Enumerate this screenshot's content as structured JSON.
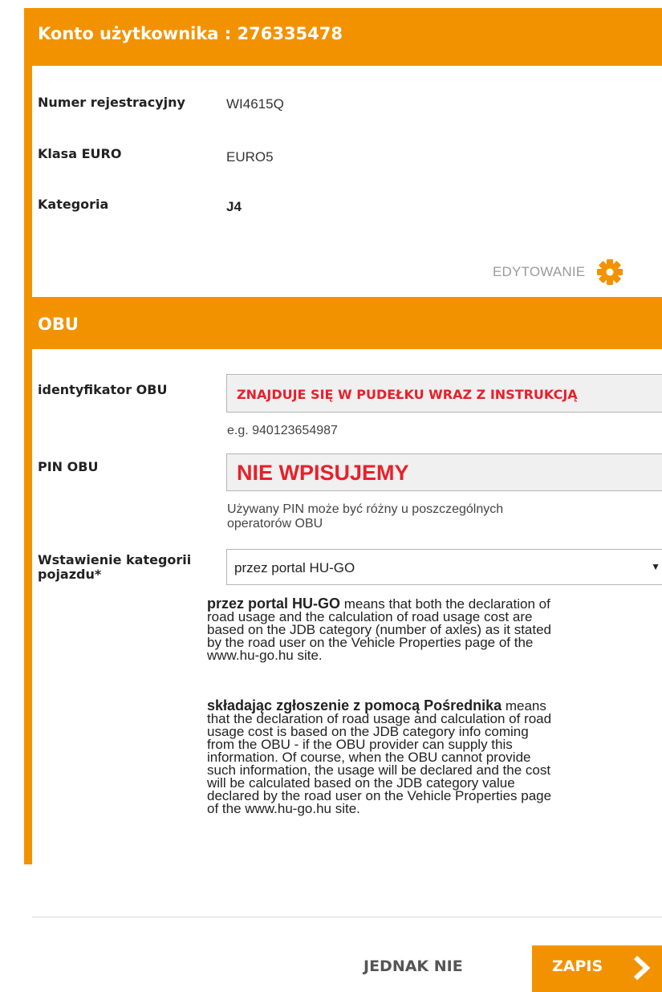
{
  "account": {
    "title": "Konto użytkownika : 276335478",
    "fields": [
      {
        "label": "Numer rejestracyjny",
        "value": "WI4615Q"
      },
      {
        "label": "Klasa EURO",
        "value": "EURO5"
      },
      {
        "label": "Kategoria",
        "value": "J4"
      }
    ],
    "edit_label": "EDYTOWANIE"
  },
  "obu": {
    "title": "OBU",
    "id_label": "identyfikator OBU",
    "id_value": "ZNAJDUJE SIĘ W PUDEŁKU WRAZ Z INSTRUKCJĄ",
    "id_hint": "e.g. 940123654987",
    "pin_label": "PIN OBU",
    "pin_value": "NIE WPISUJEMY",
    "pin_hint_1": "Używany PIN może być różny u poszczególnych",
    "pin_hint_2": "operatorów OBU",
    "category_label_1": "Wstawienie kategorii",
    "category_label_2": "pojazdu*",
    "category_selected": "przez portal HU-GO",
    "desc1_bold": "przez portal HU-GO",
    "desc1_lines": [
      " means that both the declaration of",
      "road usage and the calculation of road usage cost are",
      "based on the JDB category (number of axles) as it stated",
      "by the road user on the Vehicle Properties page of the",
      "www.hu-go.hu site."
    ],
    "desc2_bold": "składając zgłoszenie z pomocą Pośrednika",
    "desc2_lines": [
      " means",
      "that the declaration of road usage and calculation of road",
      "usage cost is based on the JDB category info coming",
      "from the OBU - if the OBU provider can supply this",
      "information. Of course, when the OBU cannot provide",
      "such information, the usage will be declared and the cost",
      "will be calculated based on the JDB category value",
      "declared by the road user on the Vehicle Properties page",
      "of the www.hu-go.hu site."
    ]
  },
  "footer": {
    "cancel_label": "JEDNAK NIE",
    "save_label": "ZAPIS"
  },
  "colors": {
    "accent": "#f39200",
    "warning_text": "#e8202a"
  }
}
